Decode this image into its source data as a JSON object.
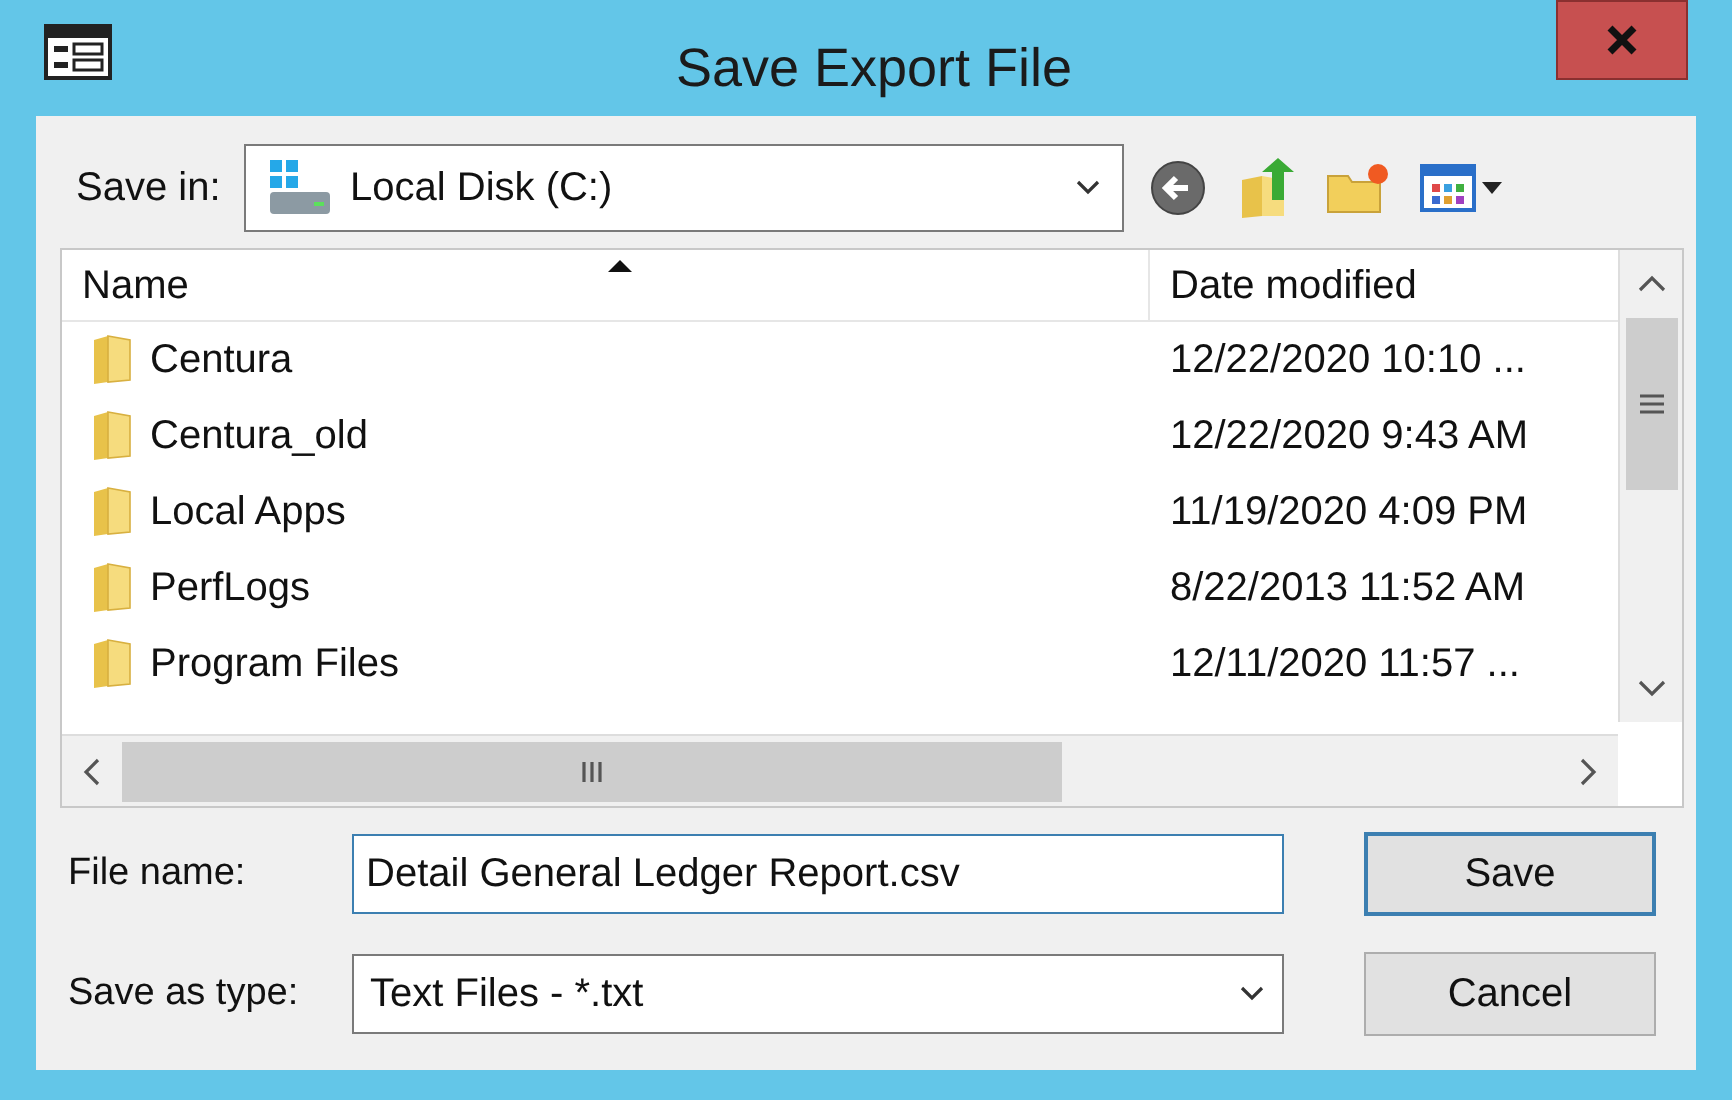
{
  "window": {
    "title": "Save Export File"
  },
  "save_in": {
    "label": "Save in:",
    "value": "Local Disk (C:)"
  },
  "file_list": {
    "columns": [
      {
        "label": "Name",
        "sorted": true
      },
      {
        "label": "Date modified",
        "sorted": false
      }
    ],
    "rows": [
      {
        "name": "Centura",
        "date": "12/22/2020 10:10 ..."
      },
      {
        "name": "Centura_old",
        "date": "12/22/2020 9:43 AM"
      },
      {
        "name": "Local Apps",
        "date": "11/19/2020 4:09 PM"
      },
      {
        "name": "PerfLogs",
        "date": "8/22/2013 11:52 AM"
      },
      {
        "name": "Program Files",
        "date": "12/11/2020 11:57 ..."
      }
    ]
  },
  "file_name": {
    "label": "File name:",
    "value": "Detail General Ledger Report.csv"
  },
  "save_as_type": {
    "label": "Save as type:",
    "value": "Text Files - *.txt"
  },
  "buttons": [
    {
      "label": "Save",
      "default": true
    },
    {
      "label": "Cancel",
      "default": false
    }
  ]
}
